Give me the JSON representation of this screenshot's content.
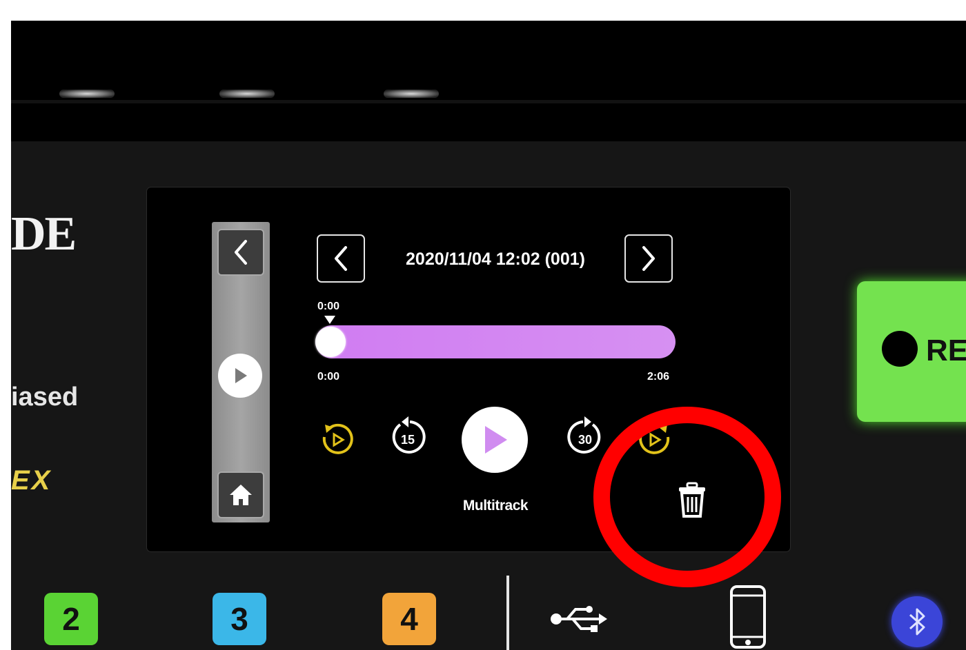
{
  "device": {
    "brand": "DE",
    "feature_text": "iased",
    "feature_text_2": "EX"
  },
  "screen": {
    "recording_title": "2020/11/04 12:02 (001)",
    "marker_time": "0:00",
    "start_time": "0:00",
    "end_time": "2:06",
    "progress": 0.0,
    "mode_label": "Multitrack",
    "skip_back_label": "15",
    "skip_forward_label": "30",
    "colors": {
      "track": "#d07cf2",
      "accent_yellow": "#e2c21a"
    },
    "icons": [
      "back-arrow-icon",
      "home-icon",
      "side-play-icon",
      "prev-recording-icon",
      "next-recording-icon",
      "loop-back-icon",
      "skip-back-15-icon",
      "play-icon",
      "skip-forward-30-icon",
      "loop-forward-icon",
      "trash-icon"
    ]
  },
  "record": {
    "label": "RE",
    "color": "#74e24f"
  },
  "channels": [
    {
      "label": "2",
      "color": "#5ad334"
    },
    {
      "label": "3",
      "color": "#3bb7e8"
    },
    {
      "label": "4",
      "color": "#f2a43a"
    }
  ],
  "connectivity": {
    "icons": [
      "usb-icon",
      "phone-icon",
      "bluetooth-icon"
    ],
    "bluetooth_color": "#3b45d8"
  },
  "annotation": {
    "color": "#ff0000"
  }
}
